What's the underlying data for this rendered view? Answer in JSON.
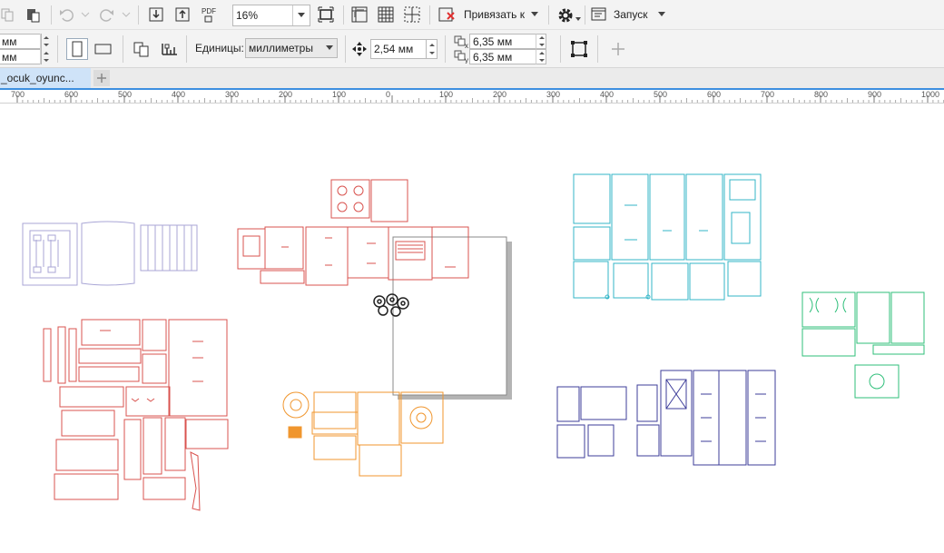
{
  "toolbar1": {
    "zoom_value": "16%",
    "snap_label": "Привязать к",
    "launch_label": "Запуск",
    "pdf_label": "PDF"
  },
  "toolbar2": {
    "width_value": "мм",
    "height_value": "мм",
    "units_label": "Единицы:",
    "units_value": "миллиметры",
    "nudge_value": "2,54 мм",
    "dup_x_value": "6,35 мм",
    "dup_y_value": "6,35 мм",
    "dup_x_axis": "x",
    "dup_y_axis": "y"
  },
  "tabs": [
    {
      "label": "_ocuk_oyunc..."
    }
  ],
  "ruler": {
    "ticks": [
      700,
      600,
      500,
      400,
      300,
      200,
      100,
      0,
      100,
      200,
      300,
      400,
      500,
      600,
      700,
      800,
      900,
      1000
    ]
  },
  "colors": {
    "red_parts": "#d9534f",
    "orange_parts": "#f0962e",
    "cyan_parts": "#33b5c7",
    "green_parts": "#2fbf7a",
    "navy_parts": "#3d3d9a",
    "lavender_parts": "#a9a6d6",
    "tab_active": "#cfe3f8",
    "accent_blue": "#3d8fe0"
  }
}
